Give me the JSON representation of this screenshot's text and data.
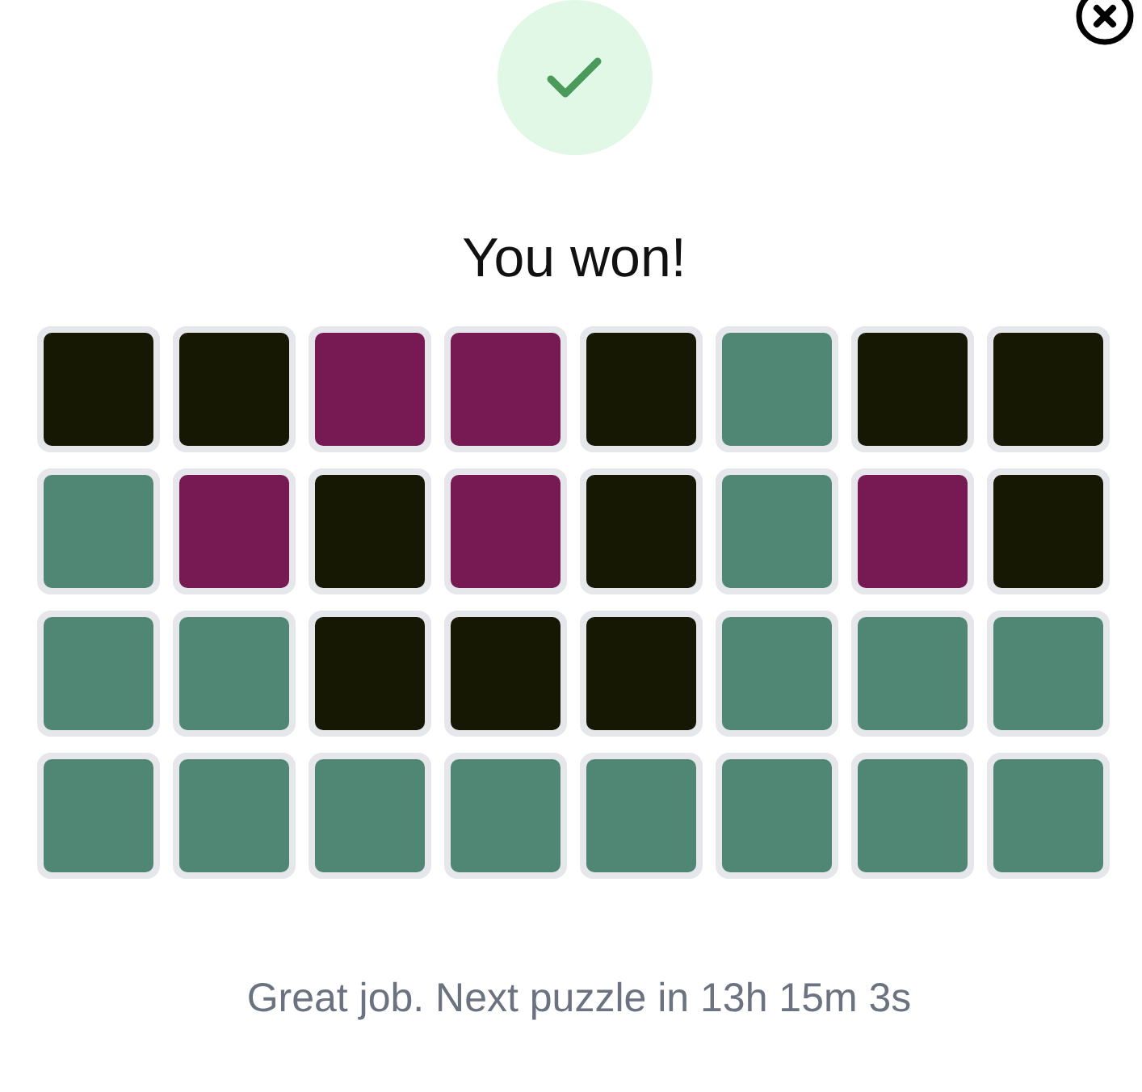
{
  "title": "You won!",
  "grid": [
    [
      {
        "color": "#171804"
      },
      {
        "color": "#171804"
      },
      {
        "color": "#771a54"
      },
      {
        "color": "#771a54"
      },
      {
        "color": "#171804"
      },
      {
        "color": "#508674"
      },
      {
        "color": "#171804"
      },
      {
        "color": "#171804"
      }
    ],
    [
      {
        "color": "#508674"
      },
      {
        "color": "#771a54"
      },
      {
        "color": "#171804"
      },
      {
        "color": "#771a54"
      },
      {
        "color": "#171804"
      },
      {
        "color": "#508674"
      },
      {
        "color": "#771a54"
      },
      {
        "color": "#171804"
      }
    ],
    [
      {
        "color": "#508674"
      },
      {
        "color": "#508674"
      },
      {
        "color": "#171804"
      },
      {
        "color": "#171804"
      },
      {
        "color": "#171804"
      },
      {
        "color": "#508674"
      },
      {
        "color": "#508674"
      },
      {
        "color": "#508674"
      }
    ],
    [
      {
        "color": "#508674"
      },
      {
        "color": "#508674"
      },
      {
        "color": "#508674"
      },
      {
        "color": "#508674"
      },
      {
        "color": "#508674"
      },
      {
        "color": "#508674"
      },
      {
        "color": "#508674"
      },
      {
        "color": "#508674"
      }
    ]
  ],
  "message": "Great job. Next puzzle in 13h 15m 3s"
}
